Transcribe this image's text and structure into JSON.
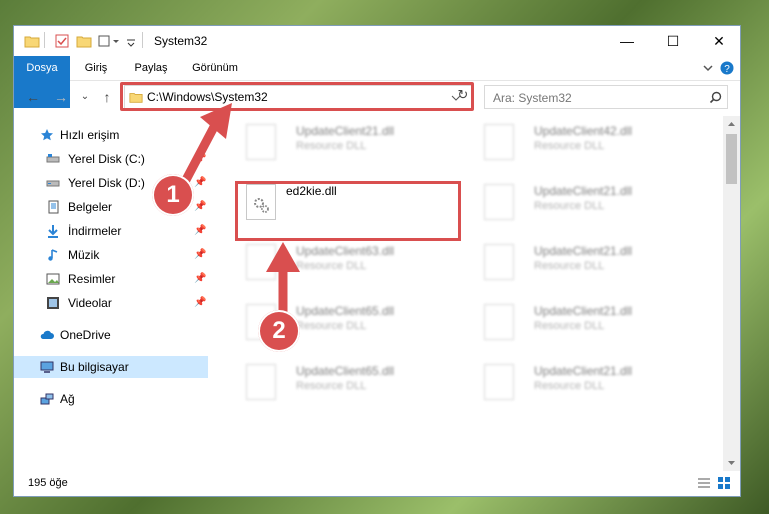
{
  "window": {
    "title": "System32",
    "minimize_glyph": "—",
    "maximize_glyph": "☐",
    "close_glyph": "✕"
  },
  "ribbon": {
    "tabs": [
      {
        "label": "Dosya"
      },
      {
        "label": "Giriş"
      },
      {
        "label": "Paylaş"
      },
      {
        "label": "Görünüm"
      }
    ]
  },
  "navigation": {
    "address": "C:\\Windows\\System32",
    "search_placeholder": "Ara: System32"
  },
  "sidebar": {
    "items": [
      {
        "label": "Hızlı erişim",
        "icon": "star-icon"
      },
      {
        "label": "Yerel Disk (C:)",
        "icon": "drive-icon"
      },
      {
        "label": "Yerel Disk (D:)",
        "icon": "drive-icon"
      },
      {
        "label": "Belgeler",
        "icon": "documents-icon"
      },
      {
        "label": "İndirmeler",
        "icon": "download-icon"
      },
      {
        "label": "Müzik",
        "icon": "music-icon"
      },
      {
        "label": "Resimler",
        "icon": "pictures-icon"
      },
      {
        "label": "Videolar",
        "icon": "video-icon"
      },
      {
        "label": "OneDrive",
        "icon": "cloud-icon"
      },
      {
        "label": "Bu bilgisayar",
        "icon": "computer-icon"
      },
      {
        "label": "Ağ",
        "icon": "network-icon"
      }
    ]
  },
  "files": {
    "items": [
      {
        "name": "UpdateClient21.dll",
        "type": "Resource DLL"
      },
      {
        "name": "UpdateClient42.dll",
        "type": "Resource DLL"
      },
      {
        "name": "ed2kie.dll",
        "type": ""
      },
      {
        "name": "UpdateClient21.dll",
        "type": "Resource DLL"
      },
      {
        "name": "UpdateClient63.dll",
        "type": "Resource DLL"
      },
      {
        "name": "UpdateClient21.dll",
        "type": "Resource DLL"
      },
      {
        "name": "UpdateClient65.dll",
        "type": "Resource DLL"
      },
      {
        "name": "UpdateClient21.dll",
        "type": "Resource DLL"
      },
      {
        "name": "UpdateClient65.dll",
        "type": "Resource DLL"
      },
      {
        "name": "UpdateClient21.dll",
        "type": "Resource DLL"
      }
    ]
  },
  "status": {
    "count": "195 öğe"
  },
  "annotations": {
    "step1": "1",
    "step2": "2"
  },
  "colors": {
    "accent": "#1979ca",
    "highlight": "#d94f4f",
    "selection": "#cce8ff"
  }
}
